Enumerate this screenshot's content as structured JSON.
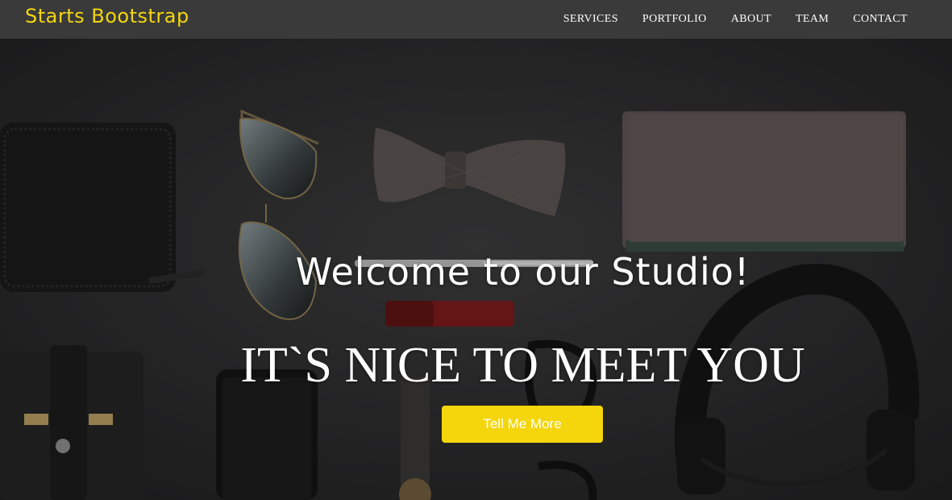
{
  "navbar": {
    "brand": "Starts Bootstrap",
    "links": [
      "SERVICES",
      "PORTFOLIO",
      "ABOUT",
      "TEAM",
      "CONTACT"
    ]
  },
  "hero": {
    "lead": "Welcome to our Studio!",
    "heading": "IT`S NICE TO MEET YOU",
    "button_label": "Tell Me More"
  },
  "colors": {
    "accent": "#f5d50c",
    "navbar_bg": "#3a3a3a",
    "hero_bg": "#2c2c2d"
  },
  "icons": [
    "wallet-icon",
    "sunglasses-icon",
    "bow-tie-icon",
    "notebook-icon",
    "pen-icon",
    "usb-drive-icon",
    "phone-icon",
    "watch-icon",
    "glasses-icon",
    "headphones-icon",
    "card-holder-icon"
  ]
}
